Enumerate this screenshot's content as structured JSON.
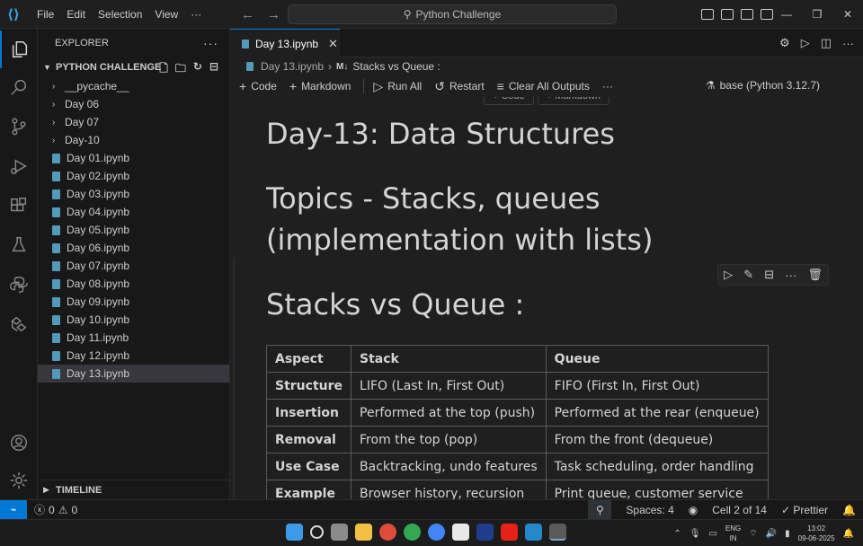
{
  "titlebar": {
    "menu": [
      "File",
      "Edit",
      "Selection",
      "View",
      "···"
    ],
    "search_text": "Python Challenge"
  },
  "sidebar": {
    "title": "EXPLORER",
    "project": "PYTHON CHALLENGE",
    "items": [
      {
        "label": "__pycache__",
        "type": "folder"
      },
      {
        "label": "Day 06",
        "type": "folder"
      },
      {
        "label": "Day 07",
        "type": "folder"
      },
      {
        "label": "Day-10",
        "type": "folder"
      },
      {
        "label": "Day 01.ipynb",
        "type": "notebook"
      },
      {
        "label": "Day 02.ipynb",
        "type": "notebook"
      },
      {
        "label": "Day 03.ipynb",
        "type": "notebook"
      },
      {
        "label": "Day 04.ipynb",
        "type": "notebook"
      },
      {
        "label": "Day 05.ipynb",
        "type": "notebook"
      },
      {
        "label": "Day 06.ipynb",
        "type": "notebook"
      },
      {
        "label": "Day 07.ipynb",
        "type": "notebook"
      },
      {
        "label": "Day 08.ipynb",
        "type": "notebook"
      },
      {
        "label": "Day 09.ipynb",
        "type": "notebook"
      },
      {
        "label": "Day 10.ipynb",
        "type": "notebook"
      },
      {
        "label": "Day 11.ipynb",
        "type": "notebook"
      },
      {
        "label": "Day 12.ipynb",
        "type": "notebook"
      },
      {
        "label": "Day 13.ipynb",
        "type": "notebook",
        "selected": true
      }
    ],
    "timeline": "TIMELINE"
  },
  "editor": {
    "tab_label": "Day 13.ipynb",
    "breadcrumb": {
      "file": "Day 13.ipynb",
      "section": "Stacks vs Queue :",
      "marker": "M↓"
    },
    "toolbar": {
      "code": "Code",
      "markdown": "Markdown",
      "run_all": "Run All",
      "restart": "Restart",
      "clear_outputs": "Clear All Outputs",
      "more": "···",
      "kernel": "base (Python 3.12.7)"
    },
    "cell_add": {
      "code": "+ Code",
      "markdown": "+ Markdown"
    }
  },
  "notebook": {
    "heading_day": "Day-13: Data Structures",
    "heading_topics": "Topics - Stacks, queues (implementation with lists)",
    "heading_stacks": "Stacks vs Queue :",
    "table": {
      "headers": [
        "Aspect",
        "Stack",
        "Queue"
      ],
      "rows": [
        [
          "Structure",
          "LIFO (Last In, First Out)",
          "FIFO (First In, First Out)"
        ],
        [
          "Insertion",
          "Performed at the top (push)",
          "Performed at the rear (enqueue)"
        ],
        [
          "Removal",
          "From the top (pop)",
          "From the front (dequeue)"
        ],
        [
          "Use Case",
          "Backtracking, undo features",
          "Task scheduling, order handling"
        ],
        [
          "Example",
          "Browser history, recursion",
          "Print queue, customer service"
        ]
      ]
    }
  },
  "statusbar": {
    "remote": "⌁",
    "errors": "0",
    "warnings": "0",
    "spaces": "Spaces: 4",
    "cell": "Cell 2 of 14",
    "prettier": "✓ Prettier"
  },
  "taskbar": {
    "lang_top": "ENG",
    "lang_bottom": "IN",
    "time": "13:02",
    "date": "09-06-2025"
  },
  "colors": {
    "accent": "#0078d4",
    "notebook_icon": "#519aba",
    "vscode_logo": "#3ca6f0"
  }
}
